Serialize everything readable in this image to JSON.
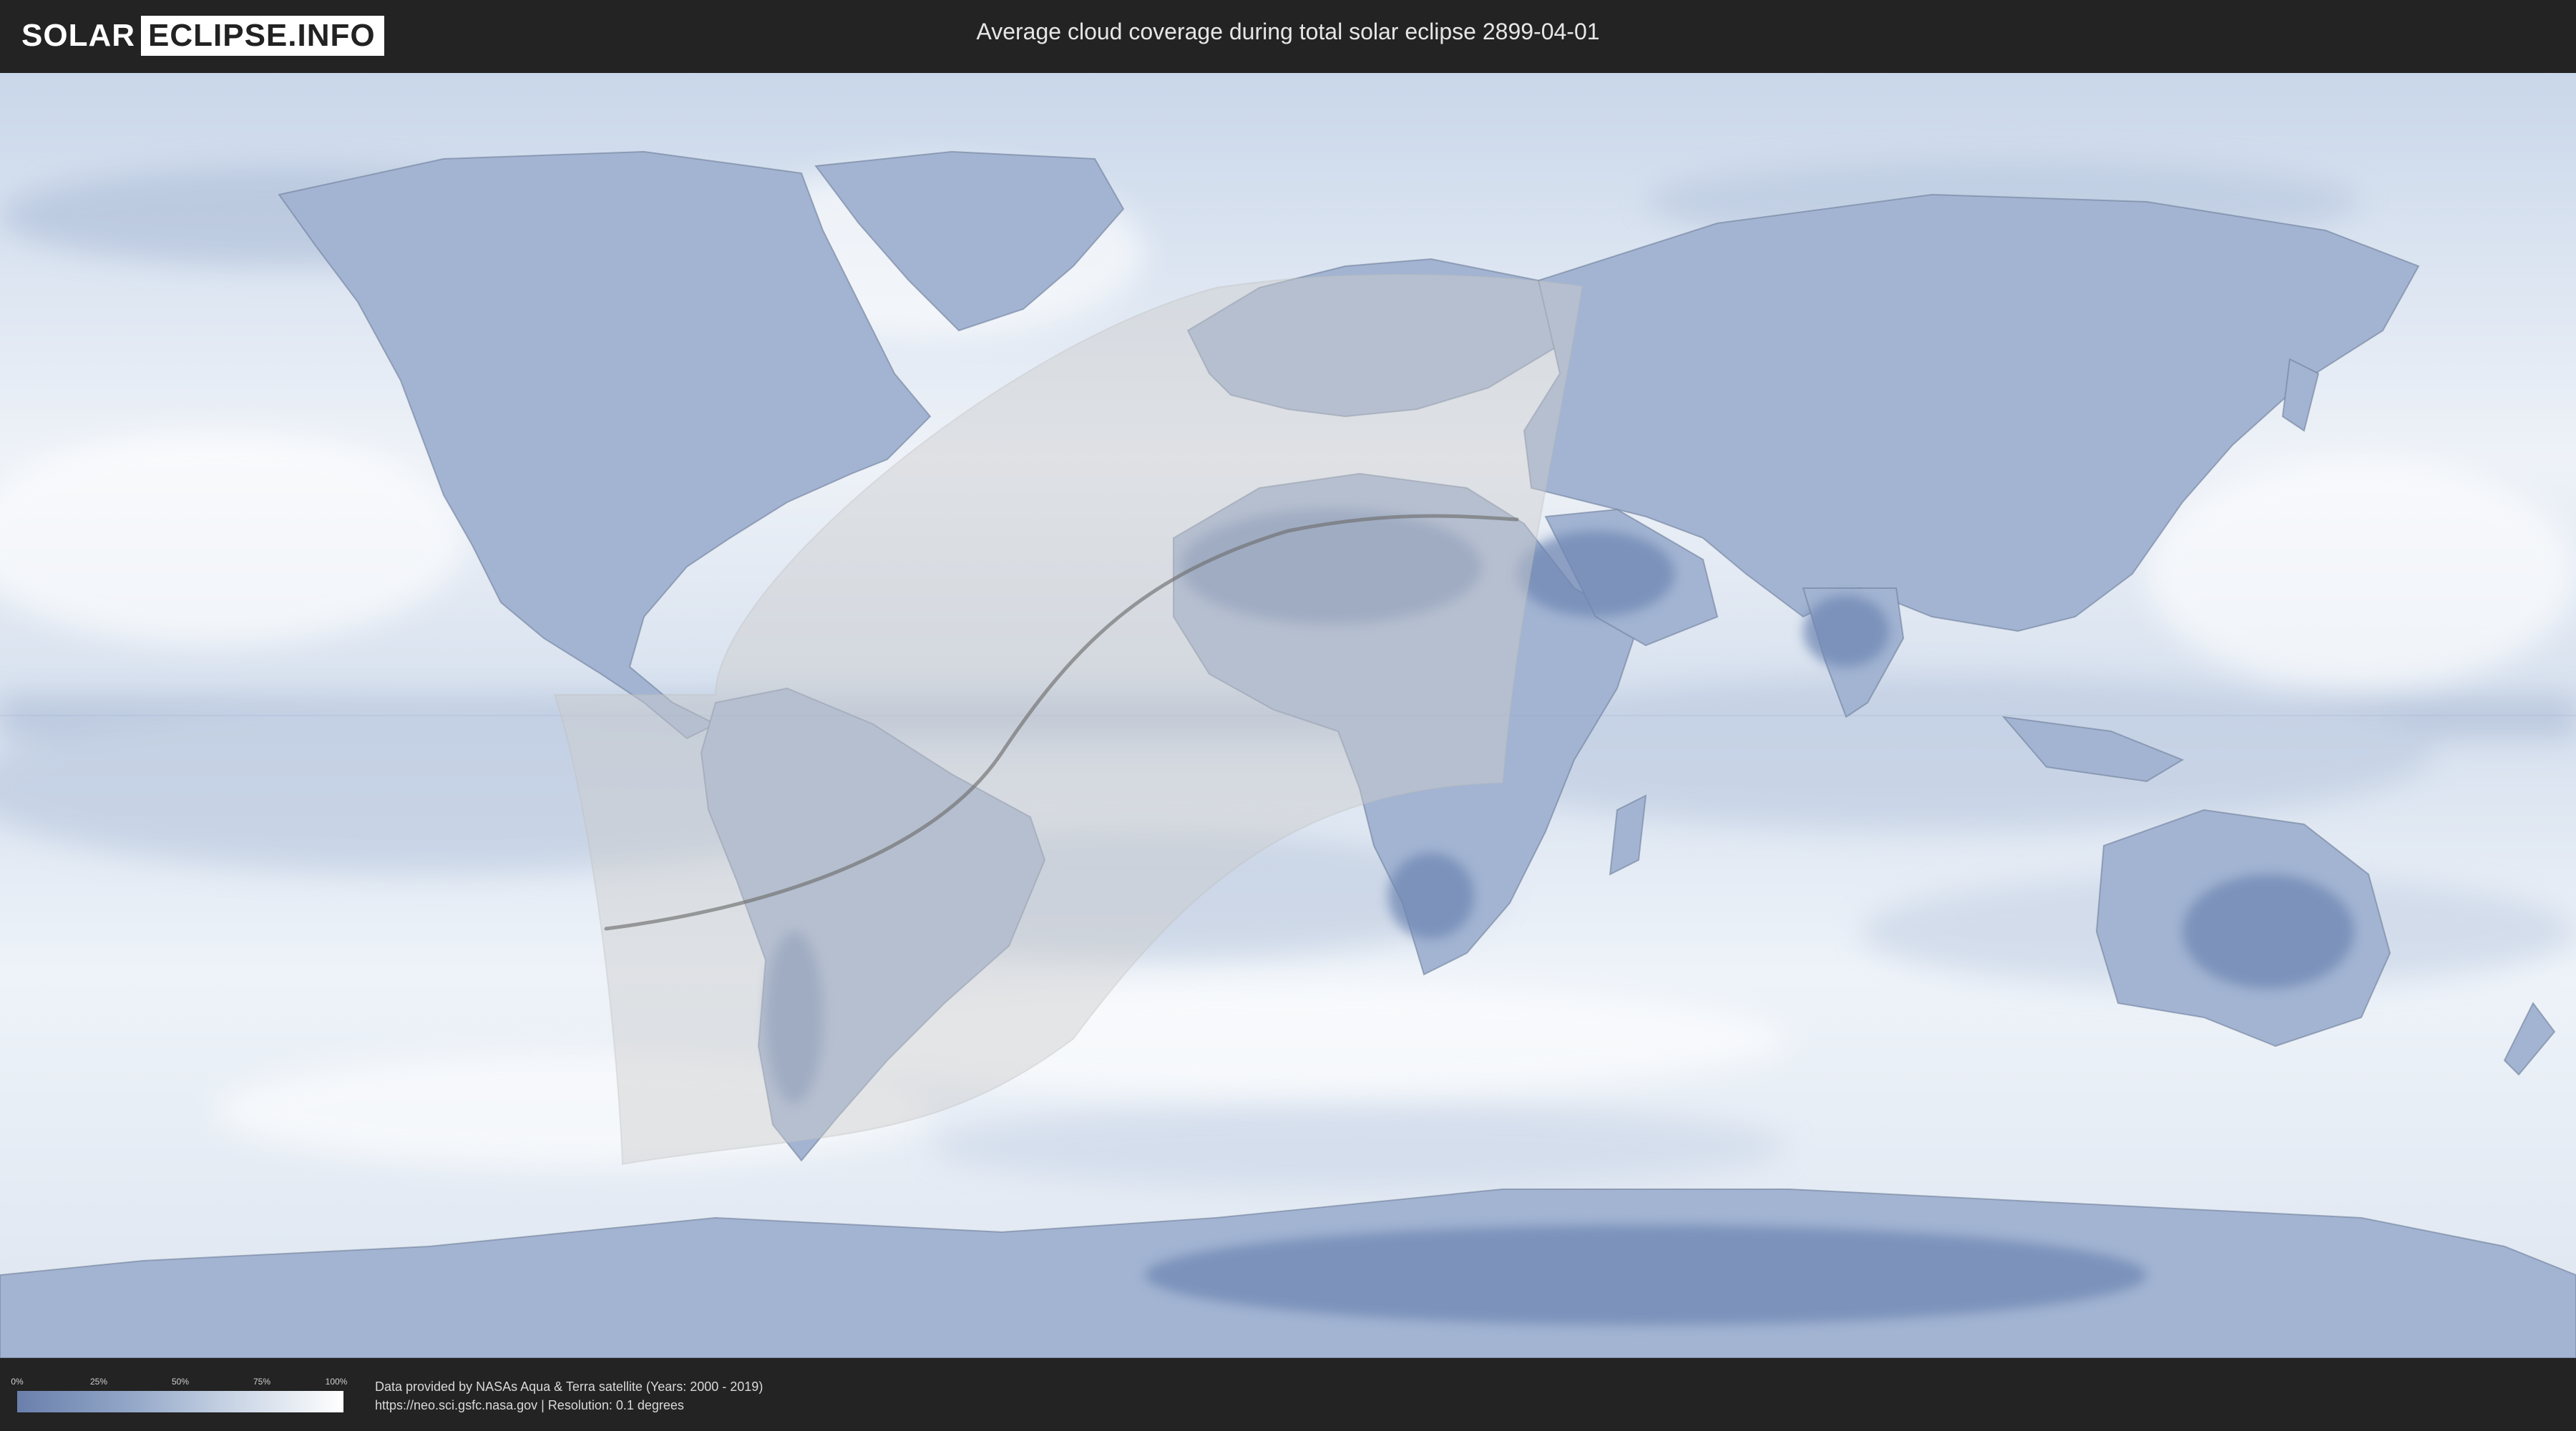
{
  "header": {
    "logo_left": "SOLAR",
    "logo_right": "ECLIPSE.INFO",
    "title": "Average cloud coverage during total solar eclipse 2899-04-01"
  },
  "legend": {
    "ticks": [
      "0%",
      "25%",
      "50%",
      "75%",
      "100%"
    ],
    "colors": [
      "#6a80ac",
      "#ffffff"
    ]
  },
  "footer": {
    "credit_line1": "Data provided by NASAs Aqua & Terra satellite (Years: 2000 - 2019)",
    "credit_line2": "https://neo.sci.gsfc.nasa.gov | Resolution: 0.1 degrees"
  },
  "map": {
    "projection": "equirectangular",
    "eclipse_type": "total",
    "date": "2899-04-01",
    "ocean_color": "#e8eef6",
    "cloud_low_color": "#7088b4",
    "shadow_fill": "#c8c8c8"
  }
}
